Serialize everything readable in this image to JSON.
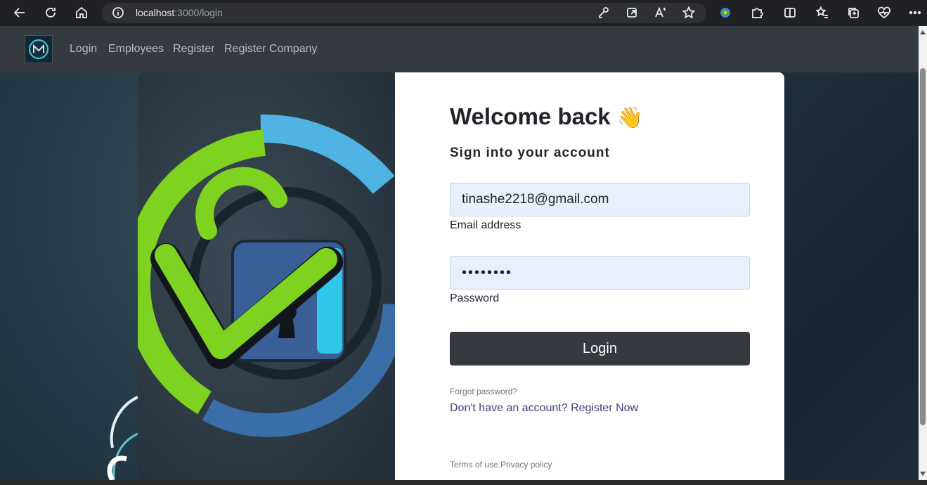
{
  "browser": {
    "url_host": "localhost",
    "url_path": ":3000/login"
  },
  "nav": {
    "links": [
      {
        "label": "Login"
      },
      {
        "label": "Employees"
      },
      {
        "label": "Register"
      },
      {
        "label": "Register Company"
      }
    ]
  },
  "login": {
    "title": "Welcome back",
    "wave_emoji": "👋",
    "subtitle": "Sign into your account",
    "email_value": "tinashe2218@gmail.com",
    "email_label": "Email address",
    "password_value": "••••••••",
    "password_label": "Password",
    "login_button": "Login",
    "forgot_password": "Forgot password?",
    "no_account_text": "Don't have an account? ",
    "register_now": "Register Now",
    "terms": "Terms of use.",
    "privacy": "Privacy policy"
  },
  "colors": {
    "navbar_bg": "#343a40",
    "button_bg": "#343a40",
    "input_bg": "#e8f0fe",
    "link_color": "#393f81",
    "logo_green": "#7ed321",
    "logo_blue": "#3fa9dd"
  }
}
